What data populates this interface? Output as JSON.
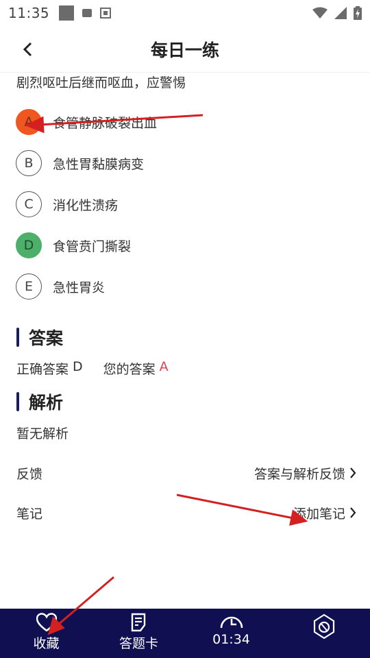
{
  "status": {
    "time": "11:35"
  },
  "header": {
    "title": "每日一练"
  },
  "question": {
    "tail": "剧烈呕吐后继而呕血，应警惕"
  },
  "options": [
    {
      "letter": "A",
      "text": "食管静脉破裂出血",
      "state": "wrong"
    },
    {
      "letter": "B",
      "text": "急性胃黏膜病变",
      "state": "normal"
    },
    {
      "letter": "C",
      "text": "消化性溃疡",
      "state": "normal"
    },
    {
      "letter": "D",
      "text": "食管贲门撕裂",
      "state": "right"
    },
    {
      "letter": "E",
      "text": "急性胃炎",
      "state": "normal"
    }
  ],
  "answer": {
    "heading": "答案",
    "correct_label": "正确答案",
    "correct_value": "D",
    "user_label": "您的答案",
    "user_value": "A"
  },
  "analysis": {
    "heading": "解析",
    "text": "暂无解析"
  },
  "feedback": {
    "label": "反馈",
    "action": "答案与解析反馈"
  },
  "notes": {
    "label": "笔记",
    "action": "添加笔记"
  },
  "bottom_bar": {
    "favorite": "收藏",
    "answer_card": "答题卡",
    "timer": "01:34"
  },
  "colors": {
    "wrong": "#f0561f",
    "right": "#4caf6a",
    "bar": "#0f0f52",
    "accent_bar": "#1c1d5e",
    "user_answer": "#e0424b",
    "annotation_arrow": "#d42020"
  }
}
